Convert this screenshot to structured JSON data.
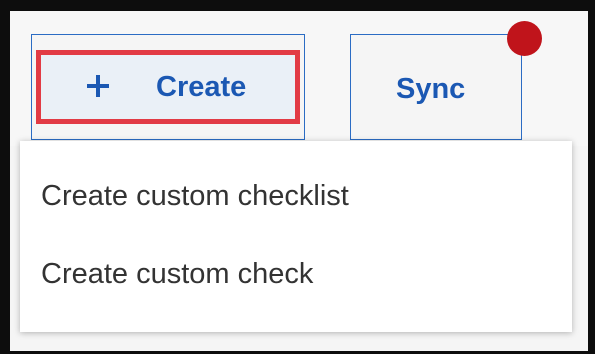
{
  "toolbar": {
    "create_label": "Create",
    "sync_label": "Sync",
    "create_icon": "plus-icon",
    "notification_color": "#c0141b",
    "accent_color": "#1b58b3",
    "highlight_color": "#e23b45"
  },
  "menu": {
    "items": [
      {
        "label": "Create custom checklist"
      },
      {
        "label": "Create custom check"
      }
    ]
  }
}
